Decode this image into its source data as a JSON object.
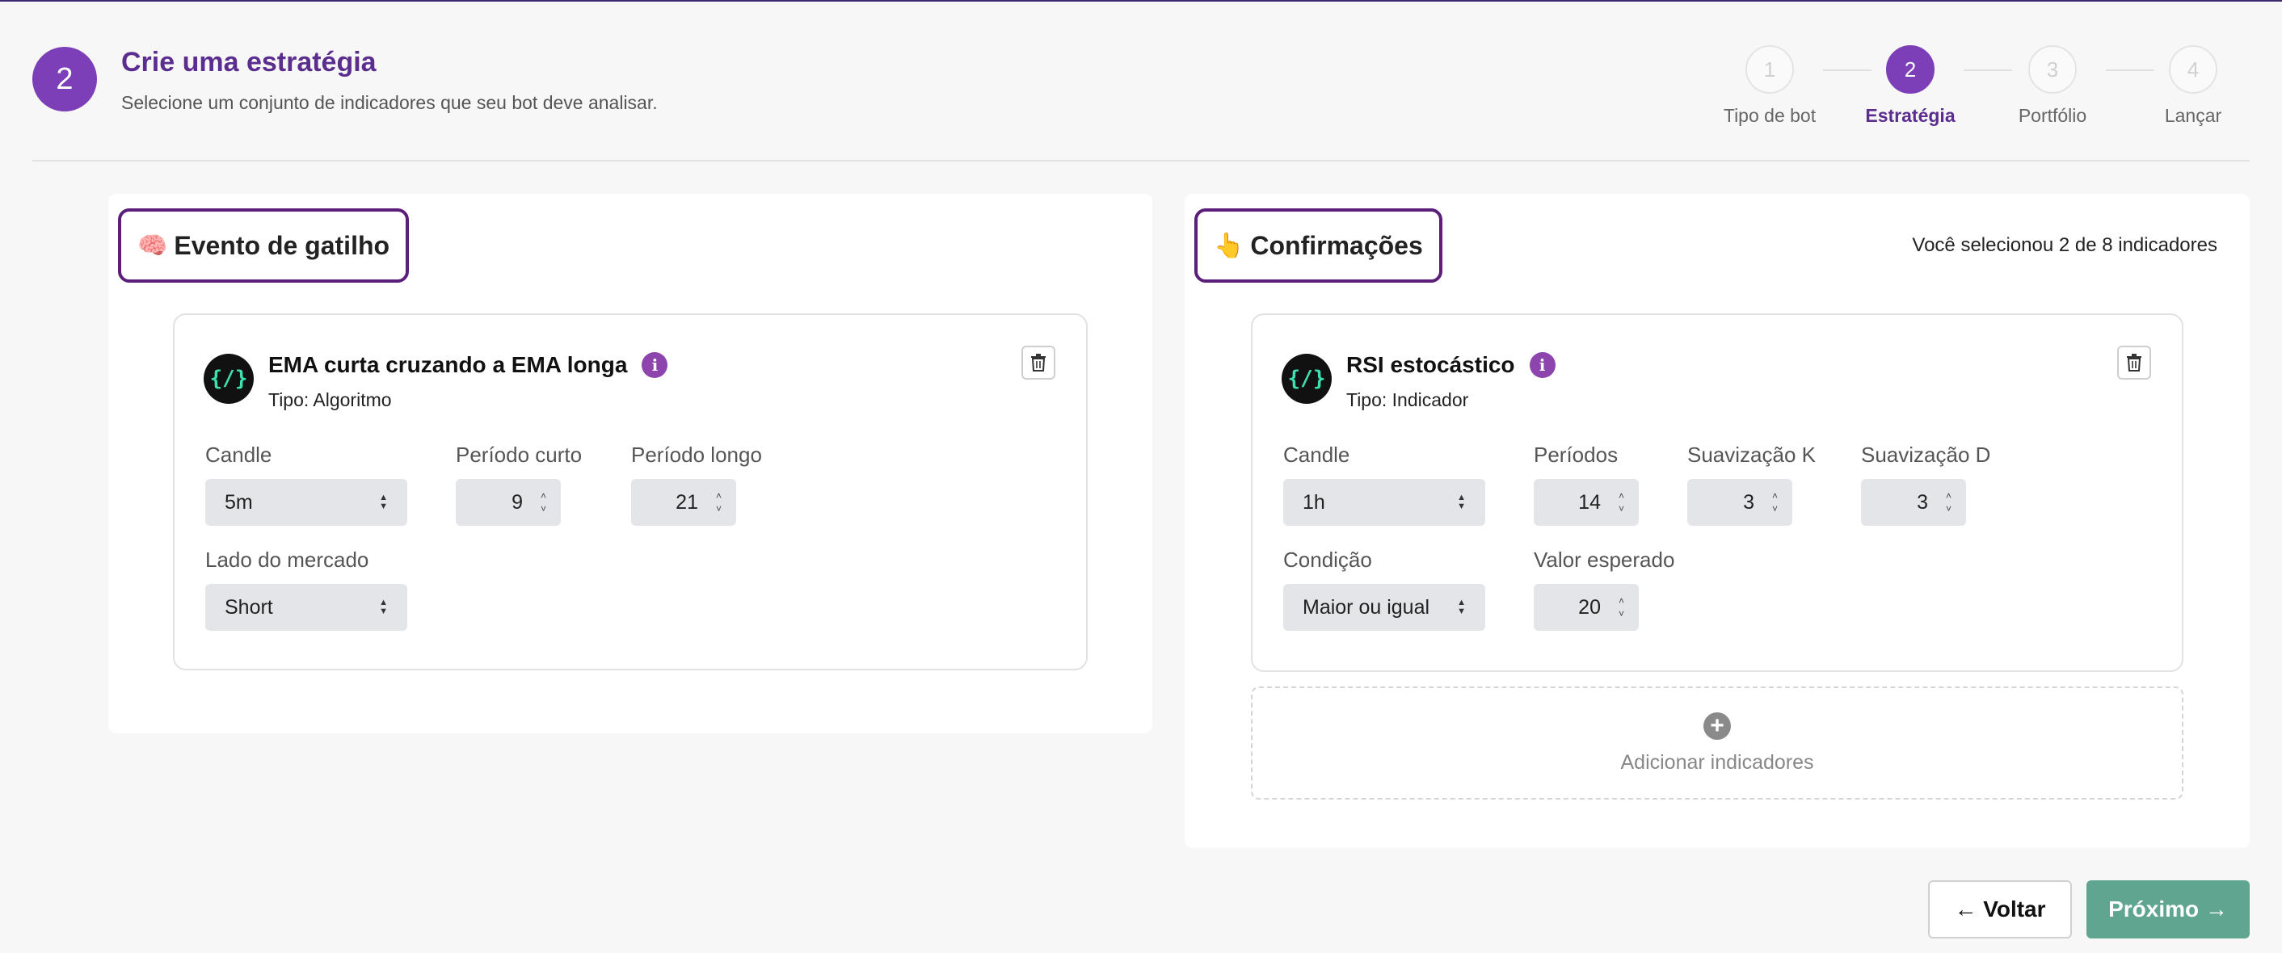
{
  "header": {
    "step_number": "2",
    "title": "Crie uma estratégia",
    "subtitle": "Selecione um conjunto de indicadores que seu bot deve analisar."
  },
  "stepper": {
    "steps": [
      {
        "number": "1",
        "label": "Tipo de bot",
        "active": false
      },
      {
        "number": "2",
        "label": "Estratégia",
        "active": true
      },
      {
        "number": "3",
        "label": "Portfólio",
        "active": false
      },
      {
        "number": "4",
        "label": "Lançar",
        "active": false
      }
    ]
  },
  "trigger": {
    "emoji": "🧠",
    "heading": "Evento de gatilho",
    "card": {
      "icon_text": "{/}",
      "title": "EMA curta cruzando a EMA longa",
      "type": "Tipo: Algoritmo",
      "candle_label": "Candle",
      "candle_value": "5m",
      "short_period_label": "Período curto",
      "short_period_value": "9",
      "long_period_label": "Período longo",
      "long_period_value": "21",
      "market_side_label": "Lado do mercado",
      "market_side_value": "Short"
    }
  },
  "confirmations": {
    "emoji": "👆",
    "heading": "Confirmações",
    "selected_info": "Você selecionou 2 de 8 indicadores",
    "card": {
      "icon_text": "{/}",
      "title": "RSI estocástico",
      "type": "Tipo: Indicador",
      "candle_label": "Candle",
      "candle_value": "1h",
      "periods_label": "Períodos",
      "periods_value": "14",
      "k_label": "Suavização K",
      "k_value": "3",
      "d_label": "Suavização D",
      "d_value": "3",
      "condition_label": "Condição",
      "condition_value": "Maior ou igual",
      "expected_label": "Valor esperado",
      "expected_value": "20"
    },
    "add_label": "Adicionar indicadores"
  },
  "footer": {
    "back_label": "← Voltar",
    "next_label": "Próximo →"
  },
  "colors": {
    "primary_purple": "#7d3fb8",
    "heading_border": "#5b1f7a",
    "next_button": "#5fa58f"
  },
  "icons": [
    "trash-icon",
    "info-icon",
    "plus-circle-icon",
    "code-icon"
  ]
}
